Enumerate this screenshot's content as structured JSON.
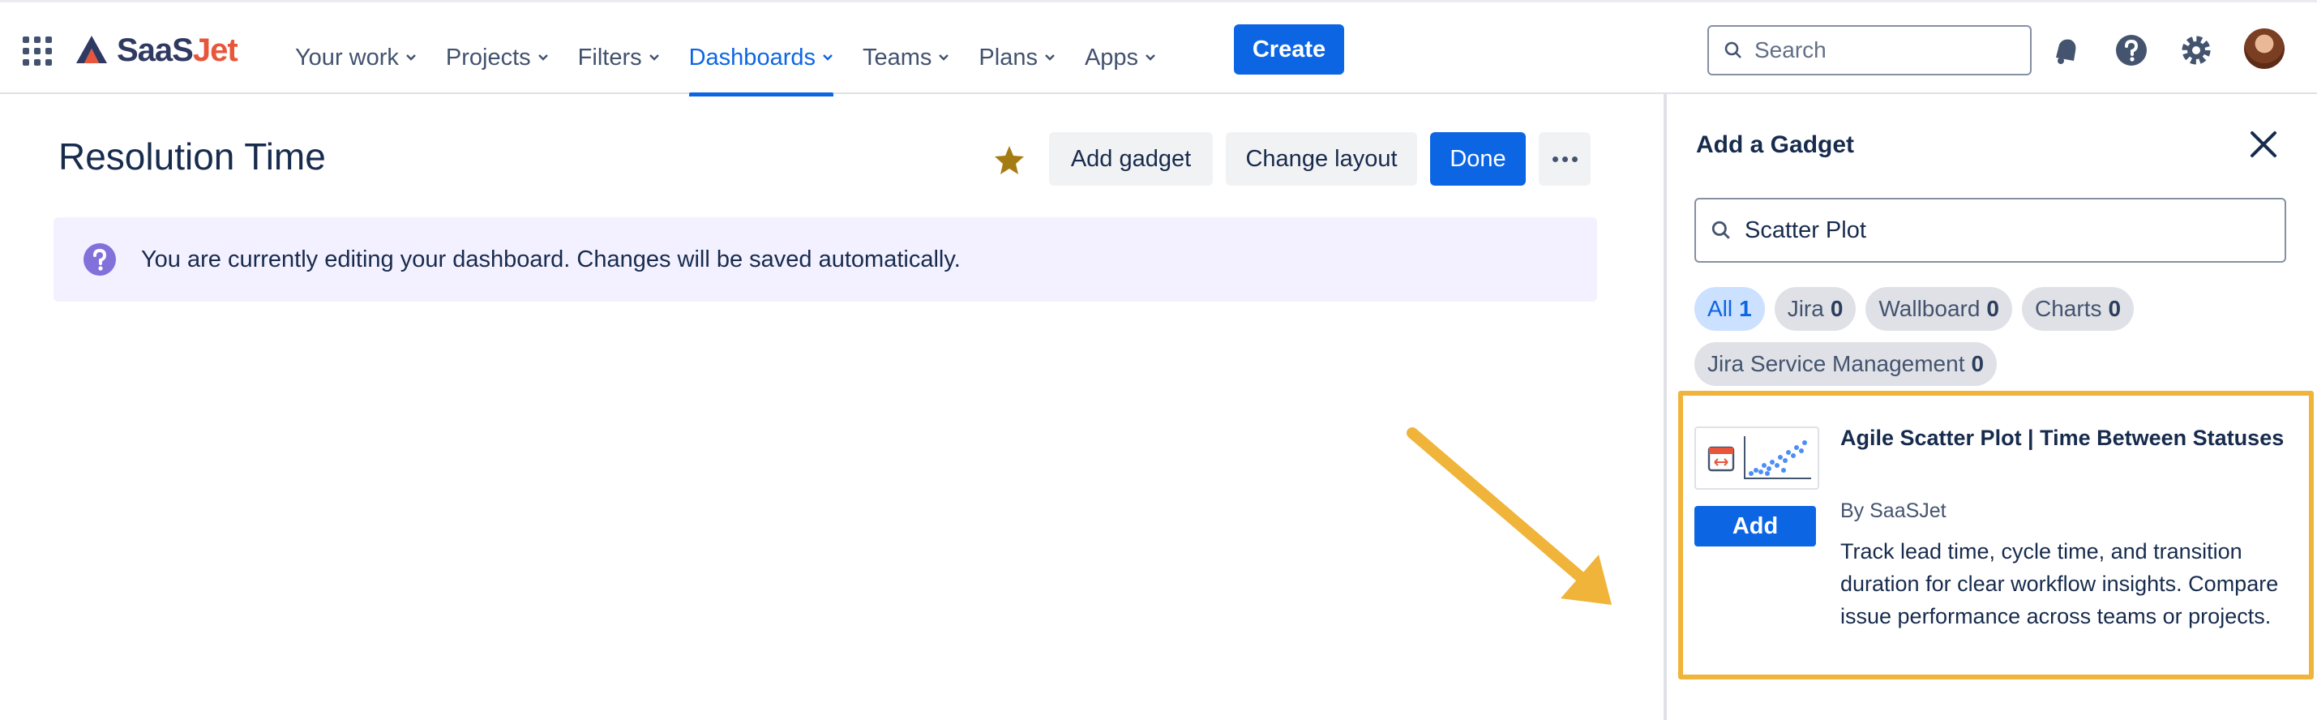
{
  "brand": {
    "logo_saas": "SaaS",
    "logo_jet": "Jet",
    "accent": "#0c66e4",
    "highlight": "#f0b43a"
  },
  "nav": {
    "items": [
      {
        "label": "Your work",
        "icon": "chevron-down-icon"
      },
      {
        "label": "Projects",
        "icon": "chevron-down-icon"
      },
      {
        "label": "Filters",
        "icon": "chevron-down-icon"
      },
      {
        "label": "Dashboards",
        "icon": "chevron-down-icon",
        "active": true
      },
      {
        "label": "Teams",
        "icon": "chevron-down-icon"
      },
      {
        "label": "Plans",
        "icon": "chevron-down-icon"
      },
      {
        "label": "Apps",
        "icon": "chevron-down-icon"
      }
    ],
    "create_label": "Create",
    "search_placeholder": "Search",
    "icons": [
      "app-switcher-icon",
      "notifications-icon",
      "help-icon",
      "settings-icon",
      "avatar"
    ]
  },
  "dashboard": {
    "title": "Resolution Time",
    "starred": true,
    "add_gadget_label": "Add gadget",
    "change_layout_label": "Change layout",
    "done_label": "Done",
    "banner_text": "You are currently editing your dashboard. Changes will be saved automatically."
  },
  "gadget_panel": {
    "title": "Add a Gadget",
    "search_value": "Scatter Plot",
    "filters": [
      {
        "label": "All",
        "count": "1",
        "selected": true
      },
      {
        "label": "Jira",
        "count": "0"
      },
      {
        "label": "Wallboard",
        "count": "0"
      },
      {
        "label": "Charts",
        "count": "0"
      },
      {
        "label": "Jira Service Management",
        "count": "0"
      }
    ],
    "result": {
      "title": "Agile Scatter Plot | Time Between Statuses",
      "by": "By SaaSJet",
      "add_label": "Add",
      "description": "Track lead time, cycle time, and transition duration for clear workflow insights. Compare issue performance across teams or projects."
    }
  }
}
